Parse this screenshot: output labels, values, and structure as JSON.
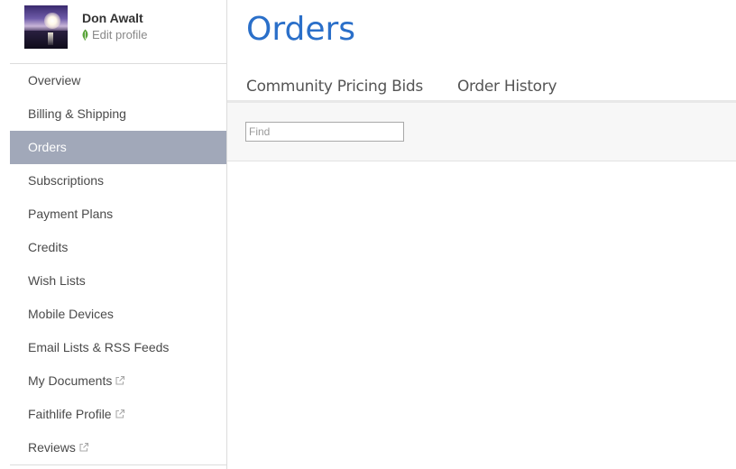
{
  "profile": {
    "name": "Don Awalt",
    "edit_label": "Edit profile"
  },
  "nav": {
    "items": [
      {
        "label": "Overview",
        "active": false,
        "external": false
      },
      {
        "label": "Billing & Shipping",
        "active": false,
        "external": false
      },
      {
        "label": "Orders",
        "active": true,
        "external": false
      },
      {
        "label": "Subscriptions",
        "active": false,
        "external": false
      },
      {
        "label": "Payment Plans",
        "active": false,
        "external": false
      },
      {
        "label": "Credits",
        "active": false,
        "external": false
      },
      {
        "label": "Wish Lists",
        "active": false,
        "external": false
      },
      {
        "label": "Mobile Devices",
        "active": false,
        "external": false
      },
      {
        "label": "Email Lists & RSS Feeds",
        "active": false,
        "external": false
      },
      {
        "label": "My Documents",
        "active": false,
        "external": true
      },
      {
        "label": "Faithlife Profile",
        "active": false,
        "external": true
      },
      {
        "label": "Reviews",
        "active": false,
        "external": true
      }
    ]
  },
  "main": {
    "title": "Orders",
    "tabs": [
      {
        "label": "Community Pricing Bids"
      },
      {
        "label": "Order History"
      }
    ],
    "search": {
      "placeholder": "Find",
      "value": ""
    }
  },
  "colors": {
    "title_blue": "#2a6fc9",
    "active_nav_bg": "#a1a8b9",
    "leaf_green": "#5aa43a",
    "external_icon": "#aaaaaa"
  },
  "icons": {
    "edit_profile": "leaf-icon",
    "external": "external-link-icon"
  }
}
